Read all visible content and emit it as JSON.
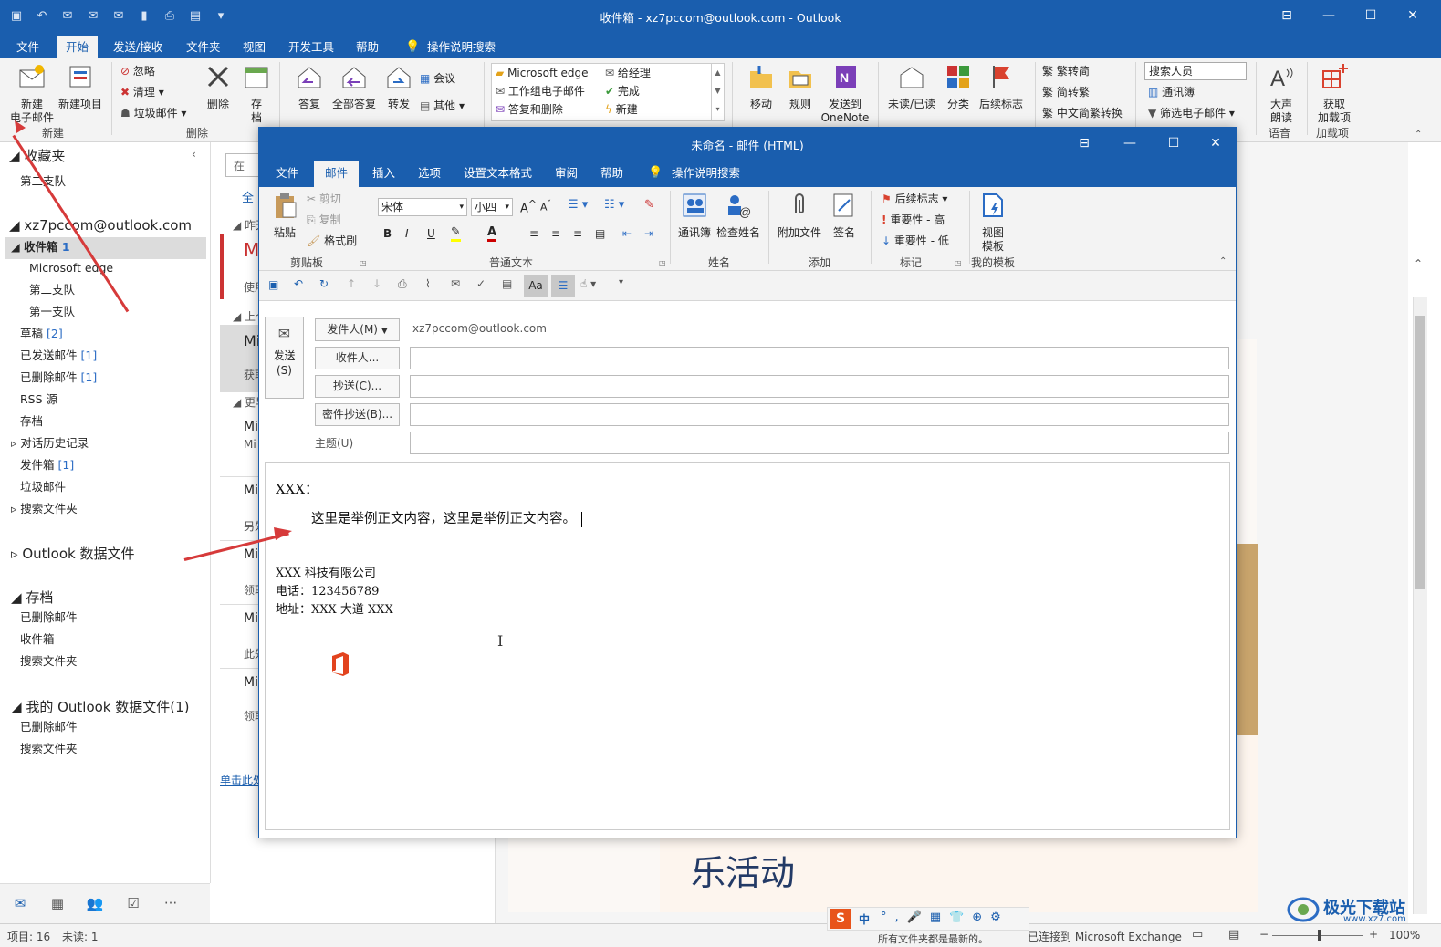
{
  "main": {
    "title": "收件箱 - xz7pccom@outlook.com  -  Outlook",
    "tabs": [
      "文件",
      "开始",
      "发送/接收",
      "文件夹",
      "视图",
      "开发工具",
      "帮助",
      "操作说明搜索"
    ],
    "active_tab": "开始",
    "ribbon": {
      "new_email": "新建\n电子邮件",
      "new_items": "新建项目",
      "ignore": "忽略",
      "cleanup": "清理",
      "junk": "垃圾邮件",
      "delete": "删除",
      "archive": "存\n档",
      "reply": "答复",
      "reply_all": "全部答复",
      "forward": "转发",
      "meeting": "会议",
      "more": "其他",
      "quick_steps": [
        "Microsoft edge",
        "给经理",
        "工作组电子邮件",
        "完成",
        "答复和删除",
        "新建"
      ],
      "move": "移动",
      "rules": "规则",
      "onenote": "发送到\nOneNote",
      "unread": "未读/已读",
      "categorize": "分类",
      "followup": "后续标志",
      "trad": "繁转简",
      "simp": "简转繁",
      "convert": "中文简繁转换",
      "search_people": "搜索人员",
      "address_book": "通讯簿",
      "filter": "筛选电子邮件",
      "read_aloud": "大声\n朗读",
      "addins": "获取\n加载项",
      "groups": {
        "new": "新建",
        "delete": "删除",
        "speech": "语音",
        "addins": "加载项"
      }
    },
    "folders": {
      "favorites": "收藏夹",
      "fav_items": [
        "第二支队"
      ],
      "account": "xz7pccom@outlook.com",
      "inbox": "收件箱",
      "inbox_count": "1",
      "inbox_sub": [
        "Microsoft edge",
        "第二支队",
        "第一支队"
      ],
      "drafts": "草稿",
      "drafts_count": "[2]",
      "sent": "已发送邮件",
      "sent_count": "[1]",
      "deleted": "已删除邮件",
      "deleted_count": "[1]",
      "rss": "RSS 源",
      "archive": "存档",
      "conv_history": "对话历史记录",
      "outbox": "发件箱",
      "outbox_count": "[1]",
      "junk": "垃圾邮件",
      "search": "搜索文件夹",
      "data_file": "Outlook 数据文件",
      "archive_head": "存档",
      "archive_items": [
        "已删除邮件",
        "收件箱",
        "搜索文件夹"
      ],
      "my_data": "我的 Outlook 数据文件(1)",
      "my_data_items": [
        "已删除邮件",
        "搜索文件夹"
      ]
    },
    "msglist": {
      "search_prefix": "在",
      "all_label": "全",
      "groups": [
        "昨天",
        "上个",
        "更早"
      ],
      "items": [
        {
          "from": "M",
          "preview": "使用"
        },
        {
          "from": "Mi",
          "preview": "获取"
        },
        {
          "from": "Mi",
          "preview": "Mi"
        },
        {
          "from": "Mi",
          "preview": "另外"
        },
        {
          "from": "Mi",
          "preview": "领取"
        },
        {
          "from": "Mi",
          "preview": "此外"
        },
        {
          "from": "Mi",
          "preview": "领取"
        }
      ],
      "link": "单击此处"
    },
    "reading": {
      "heading": "乐活动"
    },
    "status": {
      "items": "项目: 16",
      "unread": "未读: 1",
      "sync": "所有文件夹都是最新的。",
      "connected": "已连接到 Microsoft Exchange",
      "zoom": "100%"
    }
  },
  "compose": {
    "title": "未命名  -  邮件 (HTML)",
    "tabs": [
      "文件",
      "邮件",
      "插入",
      "选项",
      "设置文本格式",
      "审阅",
      "帮助",
      "操作说明搜索"
    ],
    "active_tab": "邮件",
    "ribbon": {
      "paste": "粘贴",
      "cut": "剪切",
      "copy": "复制",
      "format_painter": "格式刷",
      "font": "宋体",
      "size": "小四",
      "address_book": "通讯簿",
      "check_names": "检查姓名",
      "attach": "附加文件",
      "signature": "签名",
      "followup": "后续标志",
      "high": "重要性 - 高",
      "low": "重要性 - 低",
      "templates": "视图\n模板",
      "groups": {
        "clipboard": "剪贴板",
        "basic_text": "普通文本",
        "names": "姓名",
        "include": "添加",
        "tags": "标记",
        "my_templates": "我的模板"
      }
    },
    "send": "发送\n(S)",
    "from_btn": "发件人(M)",
    "from_value": "xz7pccom@outlook.com",
    "to_btn": "收件人...",
    "cc_btn": "抄送(C)...",
    "bcc_btn": "密件抄送(B)...",
    "subject_label": "主题(U)",
    "body": {
      "greeting": "XXX：",
      "content": "这里是举例正文内容，这里是举例正文内容。",
      "company": "XXX 科技有限公司",
      "phone": "电话：123456789",
      "address": "地址：XXX 大道 XXX"
    }
  },
  "ime": {
    "label": "中"
  },
  "watermark": {
    "text": "极光下载站",
    "url": "www.xz7.com"
  },
  "colors": {
    "accent": "#1a5eae",
    "annotation": "#d63a3a"
  }
}
